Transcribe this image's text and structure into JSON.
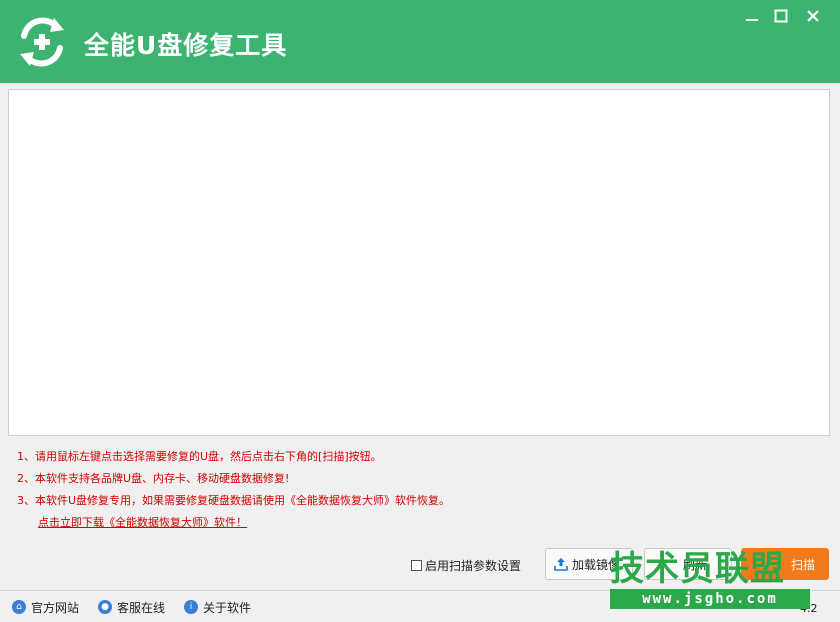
{
  "app": {
    "title": "全能U盘修复工具",
    "accent_color": "#3cb371",
    "logo_icon": "refresh-plus-icon"
  },
  "window_controls": {
    "minimize_icon": "minimize-icon",
    "maximize_icon": "maximize-icon",
    "close_icon": "close-icon"
  },
  "tips": [
    "1、请用鼠标左键点击选择需要修复的U盘，然后点击右下角的[扫描]按钮。",
    "2、本软件支持各品牌U盘、内存卡、移动硬盘数据修复!",
    "3、本软件U盘修复专用，如果需要修复硬盘数据请使用《全能数据恢复大师》软件恢复。"
  ],
  "download_link": "点击立即下载《全能数据恢复大师》软件！",
  "options": {
    "enable_scan_params_label": "启用扫描参数设置",
    "enable_scan_params_checked": false
  },
  "buttons": {
    "load_image": "加载镜像",
    "refresh": "刷新",
    "scan": "扫描",
    "scan_color": "#f27a1a"
  },
  "statusbar": {
    "items": [
      {
        "label": "官方网站",
        "icon": "home-icon"
      },
      {
        "label": "客服在线",
        "icon": "chat-icon"
      },
      {
        "label": "关于软件",
        "icon": "info-icon"
      }
    ],
    "version": "4.2"
  },
  "watermark": {
    "text": "技术员联盟",
    "url": "www.jsgho.com",
    "color": "#2aa84a"
  }
}
